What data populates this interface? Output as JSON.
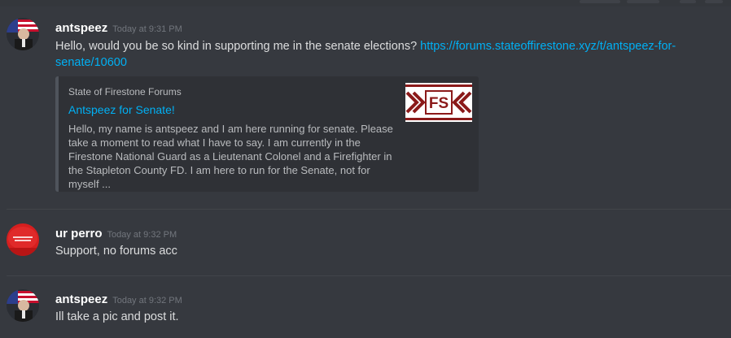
{
  "messages": [
    {
      "username": "antspeez",
      "timestamp": "Today at 9:31 PM",
      "text_before": "Hello, would you be so kind in supporting me in the senate elections? ",
      "link": "https://forums.stateoffirestone.xyz/t/antspeez-for-senate/10600",
      "embed": {
        "provider": "State of Firestone Forums",
        "title": "Antspeez for Senate!",
        "description": "Hello, my name is antspeez and I am here running for senate. Please take a moment to read what I have to say. I am currently in the Firestone National Guard as a Lieutenant Colonel and a Firefighter in the Stapleton County FD. I am here to run for the Senate, not for myself ...",
        "thumbnail_text": "FS"
      }
    },
    {
      "username": "ur perro",
      "timestamp": "Today at 9:32 PM",
      "text": "Support, no forums acc"
    },
    {
      "username": "antspeez",
      "timestamp": "Today at 9:32 PM",
      "text": "Ill take a pic and post it."
    }
  ],
  "colors": {
    "background": "#36393f",
    "link": "#00b0f4",
    "embed_bg": "#2f3136",
    "thumb_red": "#8b1a1a"
  },
  "icons": [
    "user-avatar-flag",
    "user-avatar-red-hat"
  ]
}
